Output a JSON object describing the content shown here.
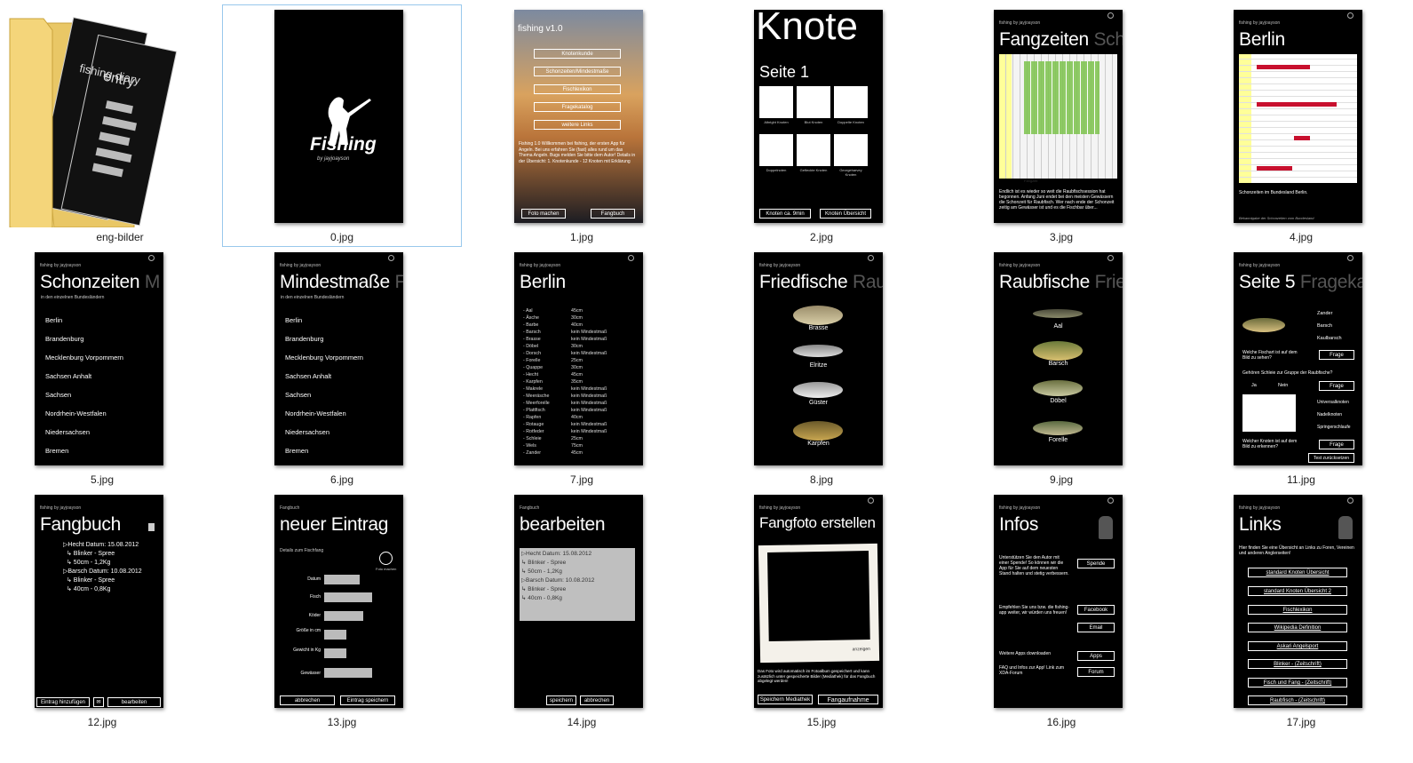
{
  "folder": {
    "name": "eng-bilder",
    "doc1": "fishing diary",
    "doc2": "entry",
    "doc2_sub": "fishing diary"
  },
  "files": [
    {
      "name": "0.jpg",
      "title": "Fishing",
      "sub": "by jayjoayson"
    },
    {
      "name": "1.jpg",
      "title": "fishing v1.0",
      "menu": [
        "Knotenkunde",
        "Schonzeiten/Mindestmaße",
        "Fischlexikon",
        "Fragekatalog",
        "weitere Links"
      ],
      "text": "Fishing 1.0 Willkommen bei fishing, der ersten App für Angeln. Bei uns erfahren Sie (fast) alles rund um das Thema Angeln. Bugs melden Sie bitte dem Autor! Details in der Übersicht: 1. Knotenkunde - 12 Knoten mit Erklärung",
      "btn_left": "Foto machen",
      "btn_right": "Fangbuch"
    },
    {
      "name": "2.jpg",
      "title": "Knote",
      "page": "Seite 1",
      "knots": [
        "Albright Knoten",
        "Blut Knoten",
        "Doppelte Knoten",
        "Doppelnoten",
        "Gefleckte Knoten",
        "Georgeharvey Knoten"
      ],
      "btn_left": "Knoten ca. 9min",
      "btn_right": "Knoten Übersicht"
    },
    {
      "name": "3.jpg",
      "hdr": "fishing by jayjoayson",
      "title": "Fangzeiten",
      "title_dim": "Sch",
      "legend": "Fangzeit",
      "text": "Endlich ist es wieder so weit die Raubfischsession hat begonnen. Anfang Juni endet bei den meisten Gewässern die Schonzeit für Raubfisch. Wer nach ende der Schonzeit zeitig am Gewässer ist und es die Fischbar über..."
    },
    {
      "name": "4.jpg",
      "hdr": "fishing by jayjoayson",
      "title": "Berlin",
      "text": "Schonzeiten im Bundesland Berlin.",
      "footer": "Bekanntgabe der Schonzeiten vom Bundesland"
    },
    {
      "name": "5.jpg",
      "hdr": "fishing by jayjoayson",
      "title": "Schonzeiten",
      "title_dim": "M",
      "sub": "in den einzelnen Bundesländern",
      "items": [
        "Berlin",
        "Brandenburg",
        "Mecklenburg Vorpommern",
        "Sachsen Anhalt",
        "Sachsen",
        "Nordrhein-Westfalen",
        "Niedersachsen",
        "Bremen"
      ]
    },
    {
      "name": "6.jpg",
      "hdr": "fishing by jayjoayson",
      "title": "Mindestmaße",
      "title_dim": "F",
      "sub": "in den einzelnen Bundesländern",
      "items": [
        "Berlin",
        "Brandenburg",
        "Mecklenburg Vorpommern",
        "Sachsen Anhalt",
        "Sachsen",
        "Nordrhein-Westfalen",
        "Niedersachsen",
        "Bremen"
      ]
    },
    {
      "name": "7.jpg",
      "hdr": "fishing by jayjoayson",
      "title": "Berlin",
      "rows": [
        [
          "- Aal",
          "45cm"
        ],
        [
          "- Äsche",
          "30cm"
        ],
        [
          "- Barbe",
          "40cm"
        ],
        [
          "- Barsch",
          "kein Mindestmaß"
        ],
        [
          "- Brasse",
          "kein Mindestmaß"
        ],
        [
          "- Döbel",
          "30cm"
        ],
        [
          "- Dorsch",
          "kein Mindestmaß"
        ],
        [
          "- Forelle",
          "25cm"
        ],
        [
          "- Quappe",
          "30cm"
        ],
        [
          "- Hecht",
          "45cm"
        ],
        [
          "- Karpfen",
          "35cm"
        ],
        [
          "- Makrele",
          "kein Mindestmaß"
        ],
        [
          "- Meeräsche",
          "kein Mindestmaß"
        ],
        [
          "- Meerforelle",
          "kein Mindestmaß"
        ],
        [
          "- Plattfisch",
          "kein Mindestmaß"
        ],
        [
          "- Rapfen",
          "40cm"
        ],
        [
          "- Rotauge",
          "kein Mindestmaß"
        ],
        [
          "- Rotfeder",
          "kein Mindestmaß"
        ],
        [
          "- Schleie",
          "25cm"
        ],
        [
          "- Wels",
          "75cm"
        ],
        [
          "- Zander",
          "45cm"
        ]
      ]
    },
    {
      "name": "8.jpg",
      "hdr": "fishing by jayjoayson",
      "title": "Friedfische",
      "title_dim": "Rau",
      "fish": [
        "Brasse",
        "Elritze",
        "Güster",
        "Karpfen"
      ]
    },
    {
      "name": "9.jpg",
      "hdr": "fishing by jayjoayson",
      "title": "Raubfische",
      "title_dim": "Frie",
      "fish": [
        "Aal",
        "Barsch",
        "Döbel",
        "Forelle"
      ]
    },
    {
      "name": "11.jpg",
      "hdr": "fishing by jayjoayson",
      "title": "Seite 5",
      "title_dim": "Frageka",
      "opts1": [
        "Zander",
        "Barsch",
        "Kaulbarsch"
      ],
      "q1": "Welche Fischart ist auf dem Bild zu sehen?",
      "q2": "Gehören Schleie zur Gruppe der Raubfische?",
      "ja": "Ja",
      "nein": "Nein",
      "opts2": [
        "Universalknoten",
        "Nadelknoten",
        "Springerschlaufe"
      ],
      "q3": "Welcher Knoten ist auf dem Bild zu erkennen?",
      "frage": "Frage",
      "reset": "Test zurücksetzen"
    },
    {
      "name": "12.jpg",
      "hdr": "fishing by jayjoayson",
      "title": "Fangbuch",
      "entries": [
        "▷Hecht   Datum: 15.08.2012",
        "↳ Blinker - Spree",
        "↳ 50cm - 1,2Kg",
        "▷Barsch  Datum: 10.08.2012",
        "↳ Blinker - Spree",
        "↳ 40cm - 0,8Kg"
      ],
      "btn_left": "Eintrag hinzufügen",
      "btn_right": "bearbeiten"
    },
    {
      "name": "13.jpg",
      "hdr": "Fangbuch",
      "title": "neuer Eintrag",
      "sub": "Details zum Fischfang",
      "photo": "Foto machen",
      "fields": [
        "Datum",
        "Fisch",
        "Köder",
        "Größe in cm",
        "Gewicht in Kg",
        "Gewässer"
      ],
      "btn_left": "abbrechen",
      "btn_right": "Eintrag speichern"
    },
    {
      "name": "14.jpg",
      "hdr": "Fangbuch",
      "title": "bearbeiten",
      "entries": [
        "▷Hecht   Datum: 15.08.2012",
        "↳ Blinker - Spree",
        "↳ 50cm - 1,2Kg",
        "▷Barsch  Datum: 10.08.2012",
        "↳ Blinker - Spree",
        "↳ 40cm - 0,8Kg"
      ],
      "btn_left": "speichern",
      "btn_right": "abbrechen"
    },
    {
      "name": "15.jpg",
      "hdr": "fishing by jayjoayson",
      "title": "Fangfoto erstellen",
      "photo_label": "anzeigen",
      "text": "Das Foto wird automatisch im Fotoalbum gespeichert und kann zusätzlich unter gespeicherte Bilder (Mediathek) für das Fangbuch abgelegt werden!",
      "btn_left": "Speichern Mediathek",
      "btn_right": "Fangaufnahme"
    },
    {
      "name": "16.jpg",
      "hdr": "fishing by jayjoayson",
      "title": "Infos",
      "t1": "Unterstützen Sie den Autor mit einer Spende! So können wir die App für Sie auf dem neuesten Stand halten und stetig verbessern.",
      "b1": "Spende",
      "t2": "Empfehlen Sie uns bzw. die fishing-app weiter, wir würden uns freuen!",
      "b2": "Facebook",
      "b3": "Email",
      "t3": "Weitere Apps downloaden",
      "b4": "Apps",
      "t4": "FAQ und Infos zur App! Link zum XDA-Forum",
      "b5": "Forum"
    },
    {
      "name": "17.jpg",
      "hdr": "fishing by jayjoayson",
      "title": "Links",
      "text": "Hier finden Sie eine Übersicht an Links zu Foren, Vereinen und anderen Anglerseiten!",
      "links": [
        "standard Knoten Übersicht",
        "standard Knoten Übersicht 2",
        "Fischlexikon",
        "Wikipedia Definition",
        "Askari Angelsport",
        "Blinker - (Zeitschrift)",
        "Fisch und Fang - (Zeitschrift)",
        "Raubfisch - (Zeitschrift)"
      ]
    }
  ]
}
